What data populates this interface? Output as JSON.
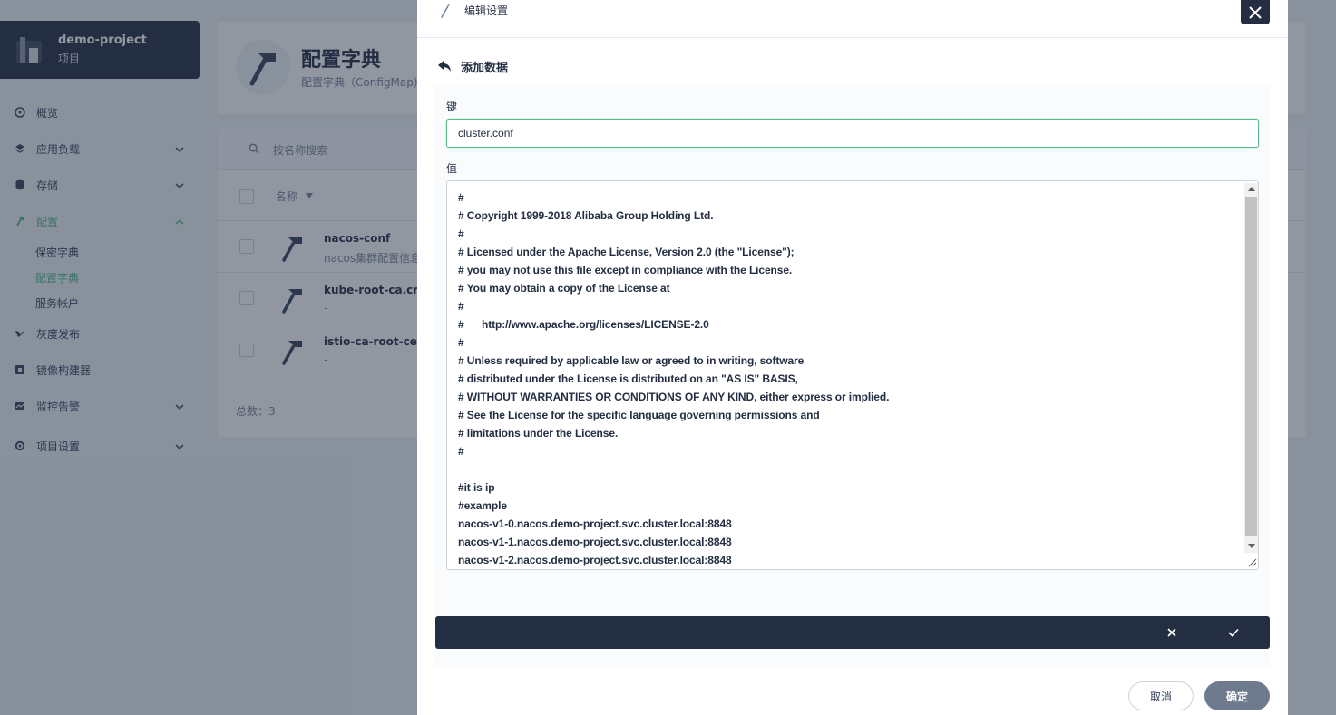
{
  "project": {
    "name": "demo-project",
    "type_label": "项目"
  },
  "nav": {
    "overview": "概览",
    "workloads": "应用负载",
    "storage": "存储",
    "config": "配置",
    "config_children": {
      "secrets": "保密字典",
      "configmaps": "配置字典",
      "service_accounts": "服务帐户"
    },
    "grayscale": "灰度发布",
    "image_builder": "镜像构建器",
    "monitoring": "监控告警",
    "project_settings": "项目设置"
  },
  "page": {
    "title": "配置字典",
    "subtitle": "配置字典（ConfigMap)",
    "search_placeholder": "按名称搜索",
    "column_name": "名称",
    "rows": [
      {
        "name": "nacos-conf",
        "desc": "nacos集群配置信息"
      },
      {
        "name": "kube-root-ca.crt",
        "desc": "-"
      },
      {
        "name": "istio-ca-root-cert",
        "desc": "-"
      }
    ],
    "total": "总数：3"
  },
  "modal": {
    "title": "编辑设置",
    "back_label": "添加数据",
    "key_label": "键",
    "key_value": "cluster.conf",
    "value_label": "值",
    "value_text": "#\n# Copyright 1999-2018 Alibaba Group Holding Ltd.\n#\n# Licensed under the Apache License, Version 2.0 (the \"License\");\n# you may not use this file except in compliance with the License.\n# You may obtain a copy of the License at\n#\n#      http://www.apache.org/licenses/LICENSE-2.0\n#\n# Unless required by applicable law or agreed to in writing, software\n# distributed under the License is distributed on an \"AS IS\" BASIS,\n# WITHOUT WARRANTIES OR CONDITIONS OF ANY KIND, either express or implied.\n# See the License for the specific language governing permissions and\n# limitations under the License.\n#\n\n#it is ip\n#example\nnacos-v1-0.nacos.demo-project.svc.cluster.local:8848\nnacos-v1-1.nacos.demo-project.svc.cluster.local:8848\nnacos-v1-2.nacos.demo-project.svc.cluster.local:8848",
    "cancel_label": "取消",
    "ok_label": "确定"
  },
  "colors": {
    "accent": "#55bc8a",
    "dark": "#242e42",
    "muted": "#79879c",
    "ok_button": "#6e7b8f"
  }
}
